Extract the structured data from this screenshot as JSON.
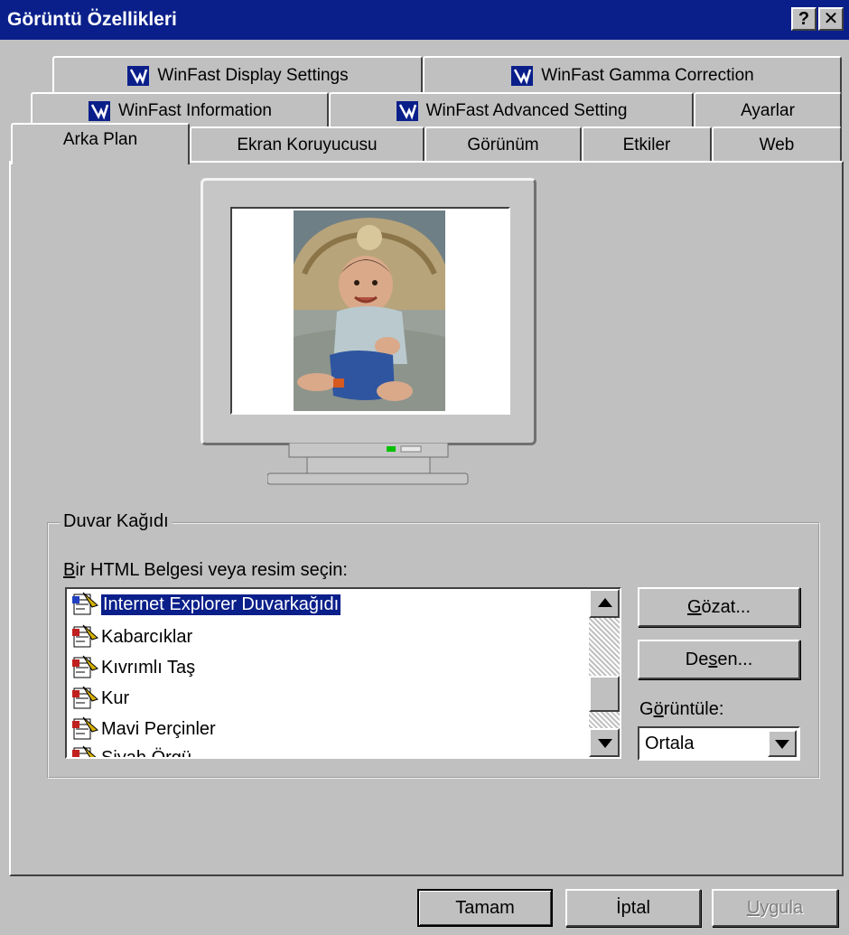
{
  "window": {
    "title": "Görüntü Özellikleri",
    "help_label": "?",
    "close_label": "✕"
  },
  "tabs": {
    "row1": [
      "WinFast Display Settings",
      "WinFast Gamma Correction"
    ],
    "row2": [
      "WinFast Information",
      "WinFast Advanced Setting",
      "Ayarlar"
    ],
    "row3": [
      "Arka Plan",
      "Ekran Koruyucusu",
      "Görünüm",
      "Etkiler",
      "Web"
    ],
    "active": "Arka Plan"
  },
  "wallpaper_group": {
    "title": "Duvar Kağıdı",
    "list_label_accel": "B",
    "list_label_rest": "ir HTML Belgesi veya resim seçin:",
    "items": [
      "Internet Explorer Duvarkağıdı",
      "Kabarcıklar",
      "Kıvrımlı Taş",
      "Kur",
      "Mavi Perçinler",
      "Siyah Örgü"
    ],
    "selected_index": 0,
    "browse_accel": "G",
    "browse_rest": "özat...",
    "pattern_pre": "De",
    "pattern_accel": "s",
    "pattern_post": "en...",
    "display_pre": "G",
    "display_accel": "ö",
    "display_post": "rüntüle:",
    "display_value": "Ortala"
  },
  "footer": {
    "ok": "Tamam",
    "cancel": "İptal",
    "apply_accel": "U",
    "apply_rest": "ygula",
    "apply_enabled": false
  },
  "colors": {
    "titlebar": "#0a1f8a",
    "face": "#c0c0c0",
    "selection": "#0a1f8a"
  }
}
